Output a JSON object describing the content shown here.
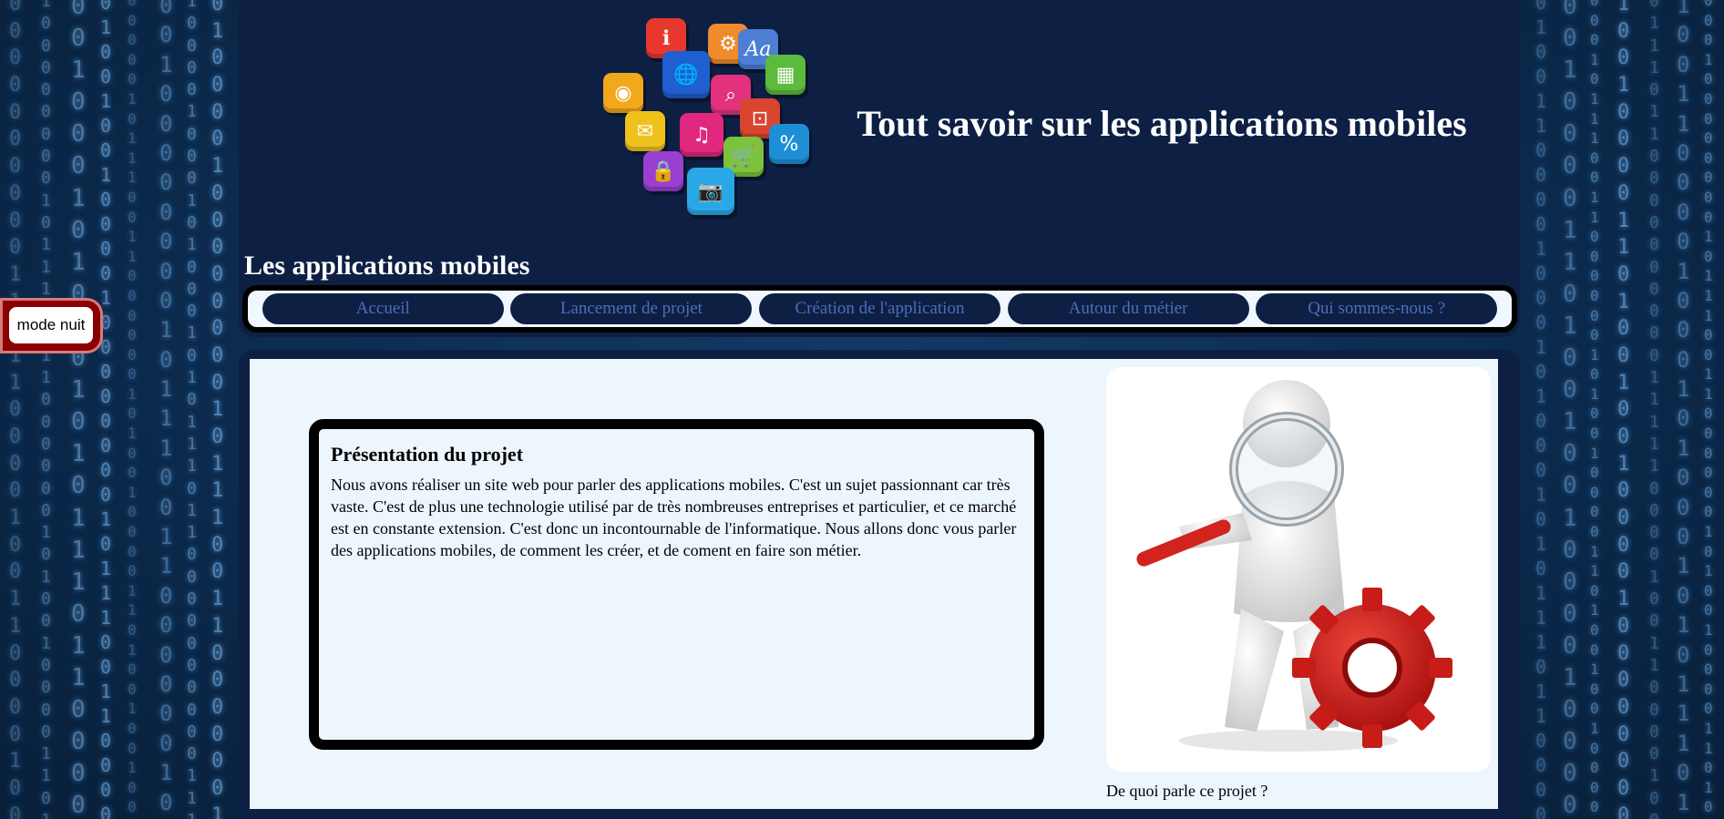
{
  "header": {
    "site_title": "Tout savoir sur les applications mobiles",
    "section_title": "Les applications mobiles"
  },
  "mode_toggle": {
    "label": "mode nuit"
  },
  "nav": {
    "items": [
      {
        "label": "Accueil"
      },
      {
        "label": "Lancement de projet"
      },
      {
        "label": "Création de l'application"
      },
      {
        "label": "Autour du métier"
      },
      {
        "label": "Qui sommes-nous ?"
      }
    ]
  },
  "main": {
    "project": {
      "heading": "Présentation du projet",
      "text": "Nous avons réaliser un site web pour parler des applications mobiles. C'est un sujet passionnant car très vaste. C'est de plus une technologie utilisé par de très nombreuses entreprises et particulier, et ce marché est en constante extension. C'est donc un incontournable de l'informatique. Nous allons donc vous parler des applications mobiles, de comment les créer, et de coment en faire son métier."
    },
    "illustration": {
      "caption": "De quoi parle ce projet ?"
    }
  },
  "colors": {
    "header_bg": "#0e1f44",
    "nav_bg": "#f0f7ff",
    "nav_pill": "#0e1f44",
    "nav_text": "#4a6fb8",
    "content_bg": "#eef6fd",
    "toggle_bg": "#8b0000"
  }
}
